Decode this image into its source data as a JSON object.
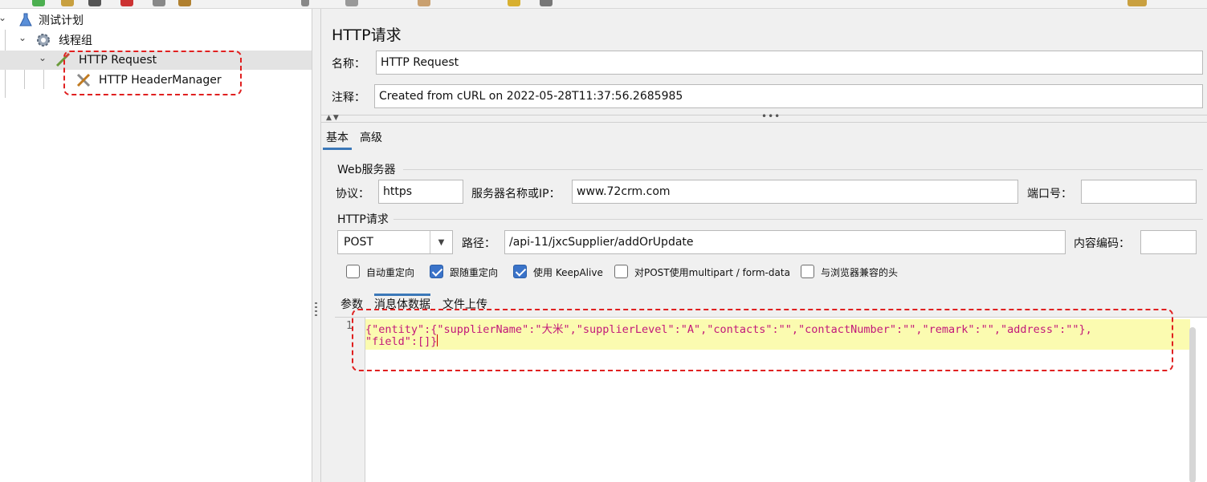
{
  "tree": {
    "items": [
      {
        "label": "测试计划",
        "icon": "test-plan-flask-icon"
      },
      {
        "label": "线程组",
        "icon": "gear-icon"
      },
      {
        "label": "HTTP Request",
        "icon": "pipette-icon"
      },
      {
        "label": "HTTP HeaderManager",
        "icon": "wrench-screwdriver-icon"
      }
    ]
  },
  "panel": {
    "title": "HTTP请求",
    "name_label": "名称：",
    "name_value": "HTTP Request",
    "comment_label": "注释：",
    "comment_value": "Created from cURL on 2022-05-28T11:37:56.2685985",
    "tabs": [
      "基本",
      "高级"
    ],
    "web_server": {
      "group_title": "Web服务器",
      "protocol_label": "协议：",
      "protocol_value": "https",
      "server_label": "服务器名称或IP：",
      "server_value": "www.72crm.com",
      "port_label": "端口号：",
      "port_value": ""
    },
    "http_request": {
      "group_title": "HTTP请求",
      "method": "POST",
      "path_label": "路径：",
      "path_value": "/api-11/jxcSupplier/addOrUpdate",
      "encoding_label": "内容编码：",
      "encoding_value": ""
    },
    "options": [
      {
        "label": "自动重定向",
        "checked": false
      },
      {
        "label": "跟随重定向",
        "checked": true
      },
      {
        "label": "使用 KeepAlive",
        "checked": true
      },
      {
        "label": "对POST使用multipart / form-data",
        "checked": false
      },
      {
        "label": "与浏览器兼容的头",
        "checked": false
      }
    ],
    "subtabs": [
      "参数",
      "消息体数据",
      "文件上传"
    ],
    "body": {
      "line_number": "1",
      "line1": "{\"entity\":{\"supplierName\":\"大米\",\"supplierLevel\":\"A\",\"contacts\":\"\",\"contactNumber\":\"\",\"remark\":\"\",\"address\":\"\"},",
      "line2": "\"field\":[]}"
    }
  },
  "colors": {
    "annotation": "#e02020",
    "tab_accent": "#3b78b8",
    "json_key": "#c2187a",
    "highlight": "#fbfbb0"
  }
}
